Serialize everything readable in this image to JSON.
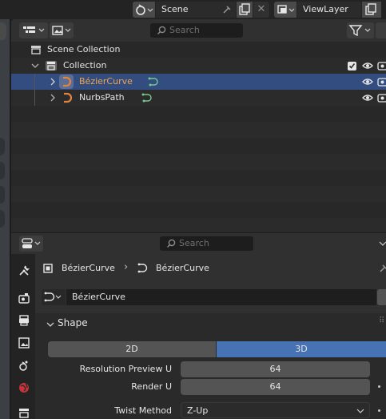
{
  "topbar": {
    "scene_label": "Scene",
    "viewlayer_label": "ViewLayer"
  },
  "outliner": {
    "search_placeholder": "Search",
    "rows": [
      {
        "label": "Scene Collection",
        "icon": "scene-collection-icon"
      },
      {
        "label": "Collection",
        "icon": "collection-icon"
      },
      {
        "label": "BézierCurve",
        "icon": "curve-object-icon",
        "selected": true
      },
      {
        "label": "NurbsPath",
        "icon": "curve-object-icon"
      }
    ]
  },
  "properties": {
    "search_placeholder": "Search",
    "breadcrumb": {
      "object": "BézierCurve",
      "data": "BézierCurve"
    },
    "datablock_name": "BézierCurve",
    "panel_title": "Shape",
    "dim_2d": "2D",
    "dim_3d": "3D",
    "resolution_preview_label": "Resolution Preview U",
    "resolution_preview_value": "64",
    "render_label": "Render U",
    "render_value": "64",
    "twist_label": "Twist Method",
    "twist_value": "Z-Up"
  },
  "colors": {
    "selection": "#334d80",
    "accent_blue": "#4772b3",
    "curve_orange": "#e5823b",
    "curve_green": "#76c88b"
  }
}
